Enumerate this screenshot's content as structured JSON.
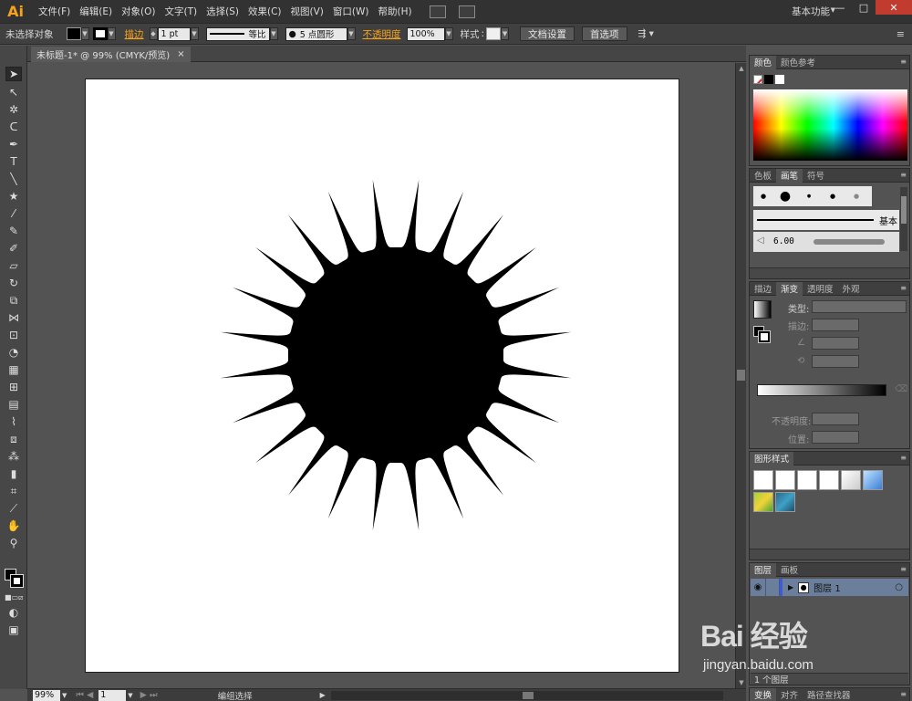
{
  "app": {
    "logo": "Ai"
  },
  "menu": [
    "文件(F)",
    "编辑(E)",
    "对象(O)",
    "文字(T)",
    "选择(S)",
    "效果(C)",
    "视图(V)",
    "窗口(W)",
    "帮助(H)"
  ],
  "workspace": "基本功能",
  "window_controls": {
    "minimize": "—",
    "maximize": "□",
    "close": "✕"
  },
  "control_bar": {
    "selection": "未选择对象",
    "stroke_label": "描边",
    "stroke_weight": "1 pt",
    "stroke_profile": "等比",
    "brush": "5 点圆形",
    "opacity_label": "不透明度",
    "opacity_value": "100%",
    "style_label": "样式",
    "doc_setup": "文档设置",
    "preferences": "首选项"
  },
  "document_tab": {
    "title": "未标题-1* @ 99% (CMYK/预览)",
    "close": "×"
  },
  "status_bar": {
    "zoom": "99%",
    "artboard": "1",
    "mode": "编组选择"
  },
  "panels": {
    "color": {
      "tabs": [
        "颜色",
        "颜色参考"
      ]
    },
    "brushes": {
      "tabs": [
        "色板",
        "画笔",
        "符号"
      ],
      "basic_label": "基本",
      "size_label": "6.00"
    },
    "gradient": {
      "tabs": [
        "描边",
        "渐变",
        "透明度",
        "外观"
      ],
      "type_label": "类型:",
      "stroke_label": "描边:",
      "opacity_label": "不透明度:",
      "position_label": "位置:"
    },
    "graphic_styles": {
      "tabs": [
        "图形样式"
      ]
    },
    "layers": {
      "tabs": [
        "图层",
        "画板"
      ],
      "layer_name": "图层 1",
      "count": "1 个图层"
    },
    "bottom_tabs": [
      "变换",
      "对齐",
      "路径查找器"
    ]
  },
  "watermark": {
    "brand": "Bai 经验",
    "url": "jingyan.baidu.com"
  },
  "colors": {
    "accent": "#f7a21b",
    "ui_dark": "#323232",
    "panel": "#535353",
    "layer_highlight": "#6b7f9c"
  }
}
